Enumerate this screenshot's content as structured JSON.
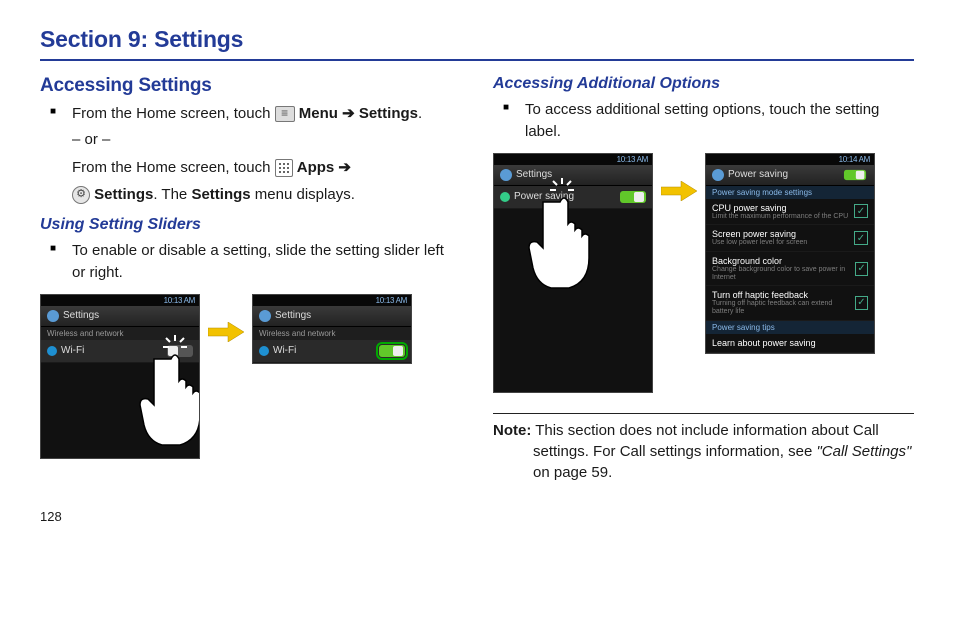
{
  "section_title": "Section 9: Settings",
  "left": {
    "heading_access": "Accessing Settings",
    "bullet1a": "From the Home screen, touch ",
    "bullet1b_bold": "Menu ➔ Settings",
    "bullet1c": ".",
    "or": "– or –",
    "line2a": "From the Home screen, touch ",
    "line2b_bold": "Apps ➔",
    "line3a_bold": "Settings",
    "line3b": ". The ",
    "line3c_bold": "Settings",
    "line3d": " menu displays.",
    "heading_sliders": "Using Setting Sliders",
    "bullet2": "To enable or disable a setting, slide the setting slider left or right.",
    "fig1": {
      "time": "10:13 AM",
      "header": "Settings",
      "sub": "Wireless and network",
      "row": "Wi-Fi"
    }
  },
  "right": {
    "heading_additional": "Accessing Additional Options",
    "bullet1": "To access additional setting options, touch the setting label.",
    "fig2": {
      "time_a": "10:13 AM",
      "time_b": "10:14 AM",
      "header": "Settings",
      "row": "Power saving",
      "detail_header": "Power saving",
      "section1": "Power saving mode settings",
      "items": [
        {
          "t": "CPU power saving",
          "s": "Limit the maximum performance of the CPU"
        },
        {
          "t": "Screen power saving",
          "s": "Use low power level for screen"
        },
        {
          "t": "Background color",
          "s": "Change background color to save power in Internet"
        },
        {
          "t": "Turn off haptic feedback",
          "s": "Turning off haptic feedback can extend battery life"
        }
      ],
      "section2": "Power saving tips",
      "item5": "Learn about power saving"
    },
    "note_label": "Note:",
    "note_body1": " This section does not include information about Call settings. For Call settings information, see ",
    "note_ref": "\"Call Settings\"",
    "note_body2": " on page 59."
  },
  "page_number": "128"
}
